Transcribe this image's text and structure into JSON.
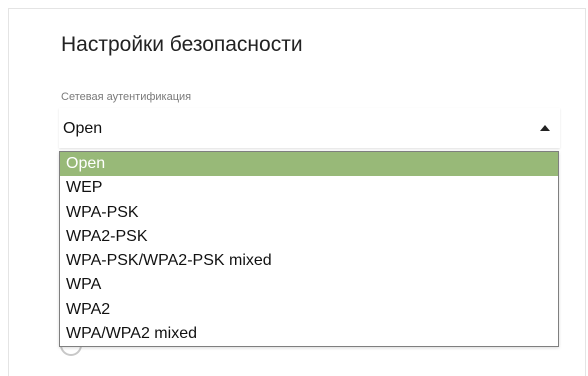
{
  "section": {
    "title": "Настройки безопасности"
  },
  "auth_field": {
    "label": "Сетевая аутентификация",
    "value": "Open",
    "options": [
      "Open",
      "WEP",
      "WPA-PSK",
      "WPA2-PSK",
      "WPA-PSK/WPA2-PSK mixed",
      "WPA",
      "WPA2",
      "WPA/WPA2 mixed"
    ],
    "selected_color": "#98b978"
  },
  "icons": {
    "caret": "caret-up-icon",
    "radio": "radio-icon"
  }
}
